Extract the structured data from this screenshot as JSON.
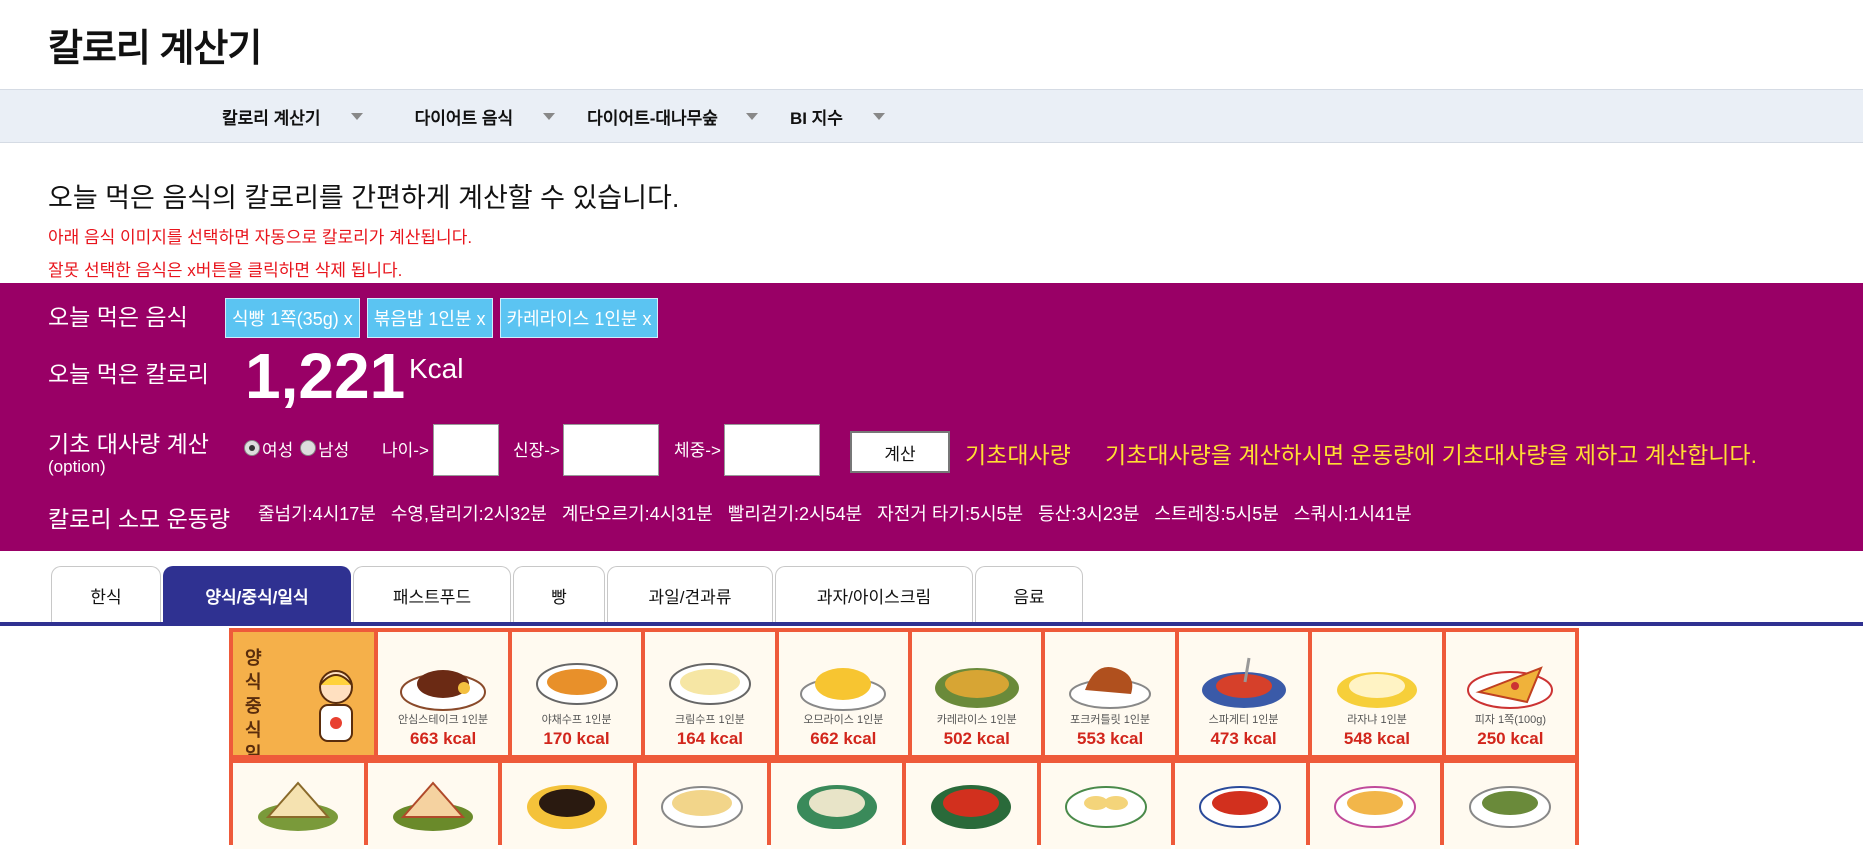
{
  "header": {
    "title": "칼로리 계산기"
  },
  "nav": {
    "items": [
      {
        "label": "칼로리 계산기"
      },
      {
        "label": "다이어트 음식"
      },
      {
        "label": "다이어트-대나무숲"
      },
      {
        "label": "BI 지수"
      }
    ]
  },
  "intro": {
    "main": "오늘 먹은 음식의 칼로리를 간편하게 계산할 수 있습니다.",
    "note1": "아래 음식 이미지를 선택하면 자동으로 칼로리가 계산됩니다.",
    "note2": "잘못 선택한 음식은 x버튼을 클릭하면 삭제 됩니다."
  },
  "panel": {
    "foods_label": "오늘 먹은 음식",
    "foods": [
      {
        "label": "식빵 1쪽(35g) x"
      },
      {
        "label": "볶음밥 1인분 x"
      },
      {
        "label": "카레라이스 1인분 x"
      }
    ],
    "calorie_label": "오늘 먹은 칼로리",
    "calorie_value": "1,221",
    "calorie_unit": "Kcal",
    "bmr_label": "기초 대사량 계산",
    "bmr_sublabel": "(option)",
    "gender_female": "여성",
    "gender_male": "남성",
    "age_label": "나이->",
    "height_label": "신장->",
    "weight_label": "체중->",
    "age_value": "",
    "height_value": "",
    "weight_value": "",
    "calc_button": "계산",
    "bmr_result_label": "기초대사량",
    "bmr_hint": "기초대사량을 계산하시면 운동량에 기초대사량을 제하고 계산합니다.",
    "exercise_label": "칼로리 소모 운동량",
    "exercises": [
      "줄넘기:4시17분",
      "수영,달리기:2시32분",
      "계단오르기:4시31분",
      "빨리걷기:2시54분",
      "자전거 타기:5시5분",
      "등산:3시23분",
      "스트레칭:5시5분",
      "스쿼시:1시41분"
    ]
  },
  "tabs": [
    {
      "label": "한식"
    },
    {
      "label": "양식/중식/일식"
    },
    {
      "label": "패스트푸드"
    },
    {
      "label": "빵"
    },
    {
      "label": "과일/견과류"
    },
    {
      "label": "과자/아이스크림"
    },
    {
      "label": "음료"
    }
  ],
  "grid": {
    "header_text": "양식 중식 일식",
    "row1": [
      {
        "name": "안심스테이크 1인분",
        "kcal": "663 kcal"
      },
      {
        "name": "야채수프 1인분",
        "kcal": "170 kcal"
      },
      {
        "name": "크림수프 1인분",
        "kcal": "164 kcal"
      },
      {
        "name": "오므라이스 1인분",
        "kcal": "662 kcal"
      },
      {
        "name": "카레라이스 1인분",
        "kcal": "502 kcal"
      },
      {
        "name": "포크커틀릿 1인분",
        "kcal": "553 kcal"
      },
      {
        "name": "스파게티 1인분",
        "kcal": "473 kcal"
      },
      {
        "name": "라자냐 1인분",
        "kcal": "548 kcal"
      },
      {
        "name": "피자 1쪽(100g)",
        "kcal": "250 kcal"
      }
    ]
  },
  "colors": {
    "panel_bg": "#990066",
    "tag_bg": "#5bc4f2",
    "tab_active": "#2f3191",
    "intro_note": "#e8141c",
    "hint_yellow": "#ffdd33",
    "grid_bg": "#ee5a3a"
  }
}
